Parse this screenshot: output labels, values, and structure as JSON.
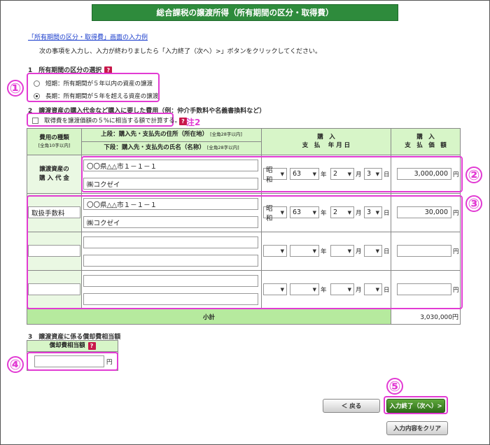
{
  "title": "総合課税の譲渡所得（所有期間の区分・取得費）",
  "example_link": "「所有期間の区分・取得費」画面の入力例",
  "instruction": "次の事項を入力し、入力が終わりましたら「入力終了（次へ）>」ボタンをクリックしてください。",
  "section1": {
    "heading": "1　所有期間の区分の選択",
    "options": [
      {
        "label": "短期：所有期間が５年以内の資産の譲渡",
        "selected": false
      },
      {
        "label": "長期：所有期間が５年を超える資産の譲渡",
        "selected": true
      }
    ]
  },
  "section2": {
    "heading": "2　譲渡資産の購入代金など購入に要した費用（例：仲介手数料や名義書換料など）",
    "checkbox_label": "取得費を譲渡価額の５%に相当する額で計算する。",
    "note": "注2",
    "headers": {
      "type": "費用の種類",
      "type_sub": "[全角10字以内]",
      "upper": "上段：購入先・支払先の住所（所在地）",
      "upper_sub": "[全角28字以内]",
      "lower": "下段：購入先・支払先の氏名（名称）",
      "lower_sub": "[全角28字以内]",
      "date": "購　入\n支　払　 年 月 日",
      "amount": "購　入\n支　払　価　額"
    },
    "row1_label": "譲渡資産の\n購 入 代 金",
    "rows": [
      {
        "type": "",
        "address": "〇〇県△△市１－１－１",
        "name": "㈱コクゼイ",
        "era": "昭和",
        "year": "63",
        "month": "2",
        "day": "3",
        "amount": "3,000,000"
      },
      {
        "type": "取扱手数料",
        "address": "〇〇県△△市１－１－１",
        "name": "㈱コクゼイ",
        "era": "昭和",
        "year": "63",
        "month": "2",
        "day": "3",
        "amount": "30,000"
      },
      {
        "type": "",
        "address": "",
        "name": "",
        "era": "",
        "year": "",
        "month": "",
        "day": "",
        "amount": ""
      },
      {
        "type": "",
        "address": "",
        "name": "",
        "era": "",
        "year": "",
        "month": "",
        "day": "",
        "amount": ""
      }
    ],
    "units": {
      "year": "年",
      "month": "月",
      "day": "日",
      "yen": "円"
    },
    "subtotal_label": "小計",
    "subtotal_value": "3,030,000円"
  },
  "section3": {
    "heading": "3　譲渡資産に係る償却費相当額",
    "box_label": "償却費相当額",
    "value": "",
    "unit": "円"
  },
  "callouts": [
    "①",
    "②",
    "③",
    "④",
    "⑤"
  ],
  "buttons": {
    "back": "＜ 戻る",
    "next": "入力終了（次へ）>",
    "clear": "入力内容をクリア"
  },
  "colors": {
    "title_bg": "#2e8b3c",
    "header_bg": "#d7f5c8",
    "subtotal_bg": "#b6ea9e",
    "callout": "#e23bd3",
    "help": "#c8174a"
  }
}
